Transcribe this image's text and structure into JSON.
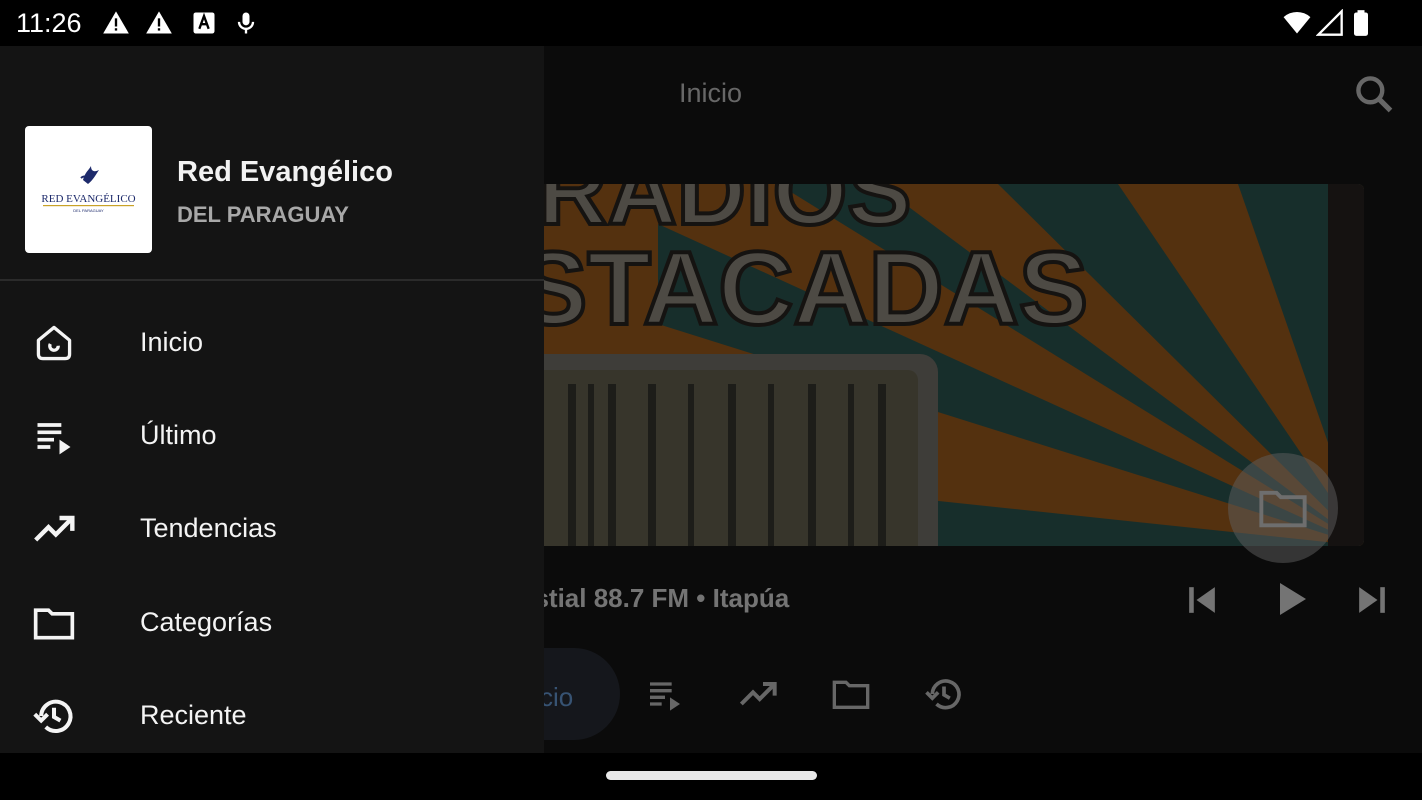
{
  "status_bar": {
    "time": "11:26",
    "icons": [
      "warning-icon",
      "warning-icon",
      "keyboard-icon",
      "mic-icon",
      "wifi-icon",
      "signal-icon",
      "battery-icon"
    ]
  },
  "app_bar": {
    "title": "Inicio",
    "search_icon": "search-icon"
  },
  "banner": {
    "line1": "RADIOS",
    "line2": "STACADAS"
  },
  "player": {
    "now_playing": "estial 88.7 FM • Itapúa",
    "controls": [
      "skip-previous-icon",
      "play-icon",
      "skip-next-icon"
    ]
  },
  "bottom_nav": {
    "active_label": "cio",
    "icons": [
      "playlist-icon",
      "trending-icon",
      "folder-icon",
      "history-icon"
    ]
  },
  "drawer": {
    "logo_text": "RED EVANGÉLICO",
    "logo_subtext": "DEL PARAGUAY",
    "title": "Red Evangélico",
    "subtitle": "DEL PARAGUAY",
    "items": [
      {
        "label": "Inicio",
        "icon": "home-icon"
      },
      {
        "label": "Último",
        "icon": "playlist-icon"
      },
      {
        "label": "Tendencias",
        "icon": "trending-icon"
      },
      {
        "label": "Categorías",
        "icon": "folder-icon"
      },
      {
        "label": "Reciente",
        "icon": "history-icon"
      }
    ]
  },
  "colors": {
    "drawer_bg": "#141414",
    "app_bg": "#161616",
    "accent": "#6fa6e6",
    "banner_teal": "#2f5c57",
    "banner_orange": "#a8621e"
  }
}
